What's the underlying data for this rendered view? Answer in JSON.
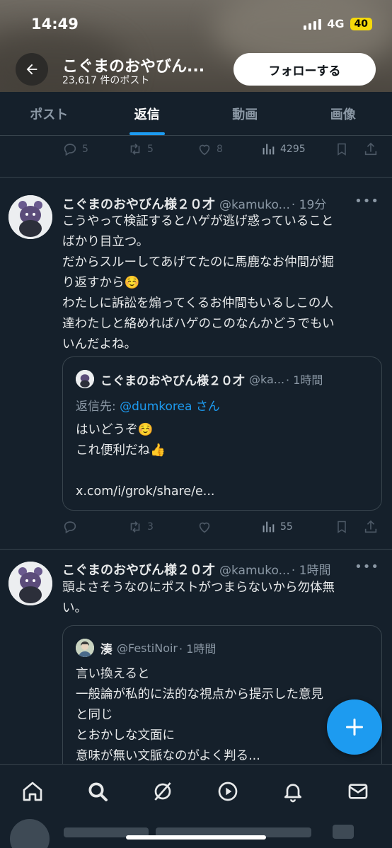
{
  "status_bar": {
    "time": "14:49",
    "network": "4G",
    "battery": "40"
  },
  "header": {
    "name": "こぐまのおやびん...",
    "post_count": "23,617 件のポスト",
    "follow_label": "フォローする"
  },
  "tabs": [
    {
      "label": "ポスト",
      "active": false
    },
    {
      "label": "返信",
      "active": true
    },
    {
      "label": "動画",
      "active": false
    },
    {
      "label": "画像",
      "active": false
    }
  ],
  "prev_tweet_actions": {
    "replies": "5",
    "reposts": "5",
    "likes": "8",
    "views": "4295"
  },
  "tweets": [
    {
      "name": "こぐまのおやびん様２０才",
      "handle": "@kamuko...",
      "time": "· 19分",
      "body_lines": [
        "こうやって検証するとハゲが逃げ惑っていること",
        "ばかり目立つ。",
        "だからスルーしてあげてたのに馬鹿なお仲間が掘",
        "り返すから☺️",
        "わたしに訴訟を煽ってくるお仲間もいるしこの人",
        "達わたしと絡めればハゲのこのなんかどうでもい",
        "いんだよね。"
      ],
      "quote": {
        "name": "こぐまのおやびん様２０才",
        "handle": "@ka...",
        "time": "· 1時間",
        "reply_to_prefix": "返信先: ",
        "reply_to_handle": "@dumkorea さん",
        "body_lines": [
          "はいどうぞ☺️",
          "これ便利だね👍",
          "",
          "x.com/i/grok/share/e..."
        ]
      },
      "actions": {
        "replies": "",
        "reposts": "3",
        "likes": "",
        "views": "55"
      }
    },
    {
      "name": "こぐまのおやびん様２０才",
      "handle": "@kamuko...",
      "time": "· 1時間",
      "body_lines": [
        "頭よさそうなのにポストがつまらないから勿体無",
        "い。"
      ],
      "quote": {
        "name": "湊",
        "handle": "@FestiNoir",
        "time": "· 1時間",
        "body_lines": [
          "言い換えると",
          "一般論が私的に法的な視点から提示した意見",
          "と同じ",
          "とおかしな文面に",
          "意味が無い文脈なのがよく判る..."
        ]
      }
    }
  ],
  "colors": {
    "background": "#15202b",
    "accent": "#1d9bf0",
    "muted": "#8b98a5",
    "border": "#38444d"
  }
}
